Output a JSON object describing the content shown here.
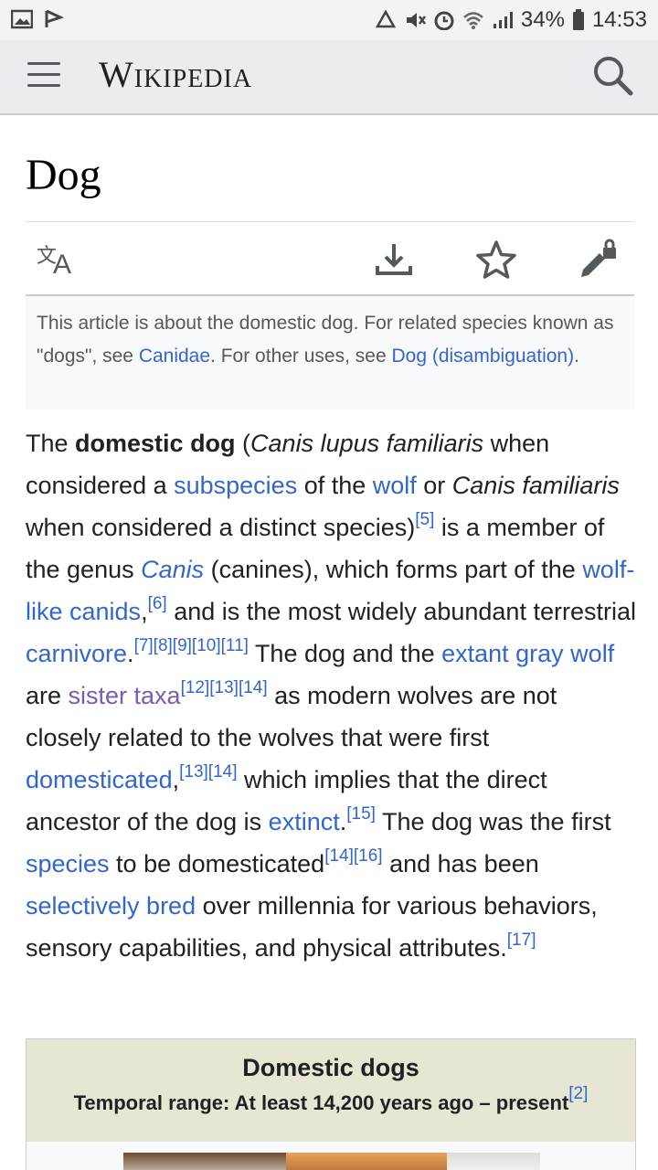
{
  "status": {
    "battery": "34%",
    "time": "14:53"
  },
  "app": {
    "wordmark": "Wikipedia"
  },
  "page": {
    "title": "Dog"
  },
  "hatnote": {
    "p1": "This article is about the domestic dog. For related species known as \"dogs\", see ",
    "link1": "Canidae",
    "p2": ". For other uses, see ",
    "link2": "Dog (disambiguation)",
    "p3": "."
  },
  "lead": {
    "t1": "The ",
    "b1": "domestic dog",
    "t2": " (",
    "i1": "Canis lupus familiaris",
    "t3": " when considered a ",
    "l_subspecies": "subspecies",
    "t4": " of the ",
    "l_wolf": "wolf",
    "t5": " or ",
    "i2": "Canis familiaris",
    "t6": " when considered a distinct species)",
    "r5": "[5]",
    "t7": " is a member of the genus ",
    "l_canis": "Canis",
    "t8": " (canines), which forms part of the ",
    "l_wolflike": "wolf-like canids",
    "t9": ",",
    "r6": "[6]",
    "t10": " and is the most widely abundant terrestrial ",
    "l_carnivore": "carnivore",
    "t11": ".",
    "r7_11": "[7][8][9][10][11]",
    "t12": " The dog and the ",
    "l_extant": "extant gray wolf",
    "t13": " are ",
    "l_sister": "sister taxa",
    "r12_14": "[12][13][14]",
    "t14": " as modern wolves are not closely related to the wolves that were first ",
    "l_domesticated": "domesticated",
    "t15": ",",
    "r13_14": "[13][14]",
    "t16": " which implies that the direct ancestor of the dog is ",
    "l_extinct": "extinct",
    "t17": ".",
    "r15": "[15]",
    "t18": " The dog was the first ",
    "l_species": "species",
    "t19": " to be domesticated",
    "r14_16": "[14][16]",
    "t20": " and has been ",
    "l_bred": "selectively bred",
    "t21": " over millennia for various behaviors, sensory capabilities, and physical attributes.",
    "r17": "[17]"
  },
  "infobox": {
    "title": "Domestic dogs",
    "range": "Temporal range: At least 14,200 years ago – present",
    "range_ref": "[2]"
  },
  "colors": {
    "link": "#3366cc",
    "visited": "#795cb2",
    "infobox_header": "#e6e6d2"
  }
}
